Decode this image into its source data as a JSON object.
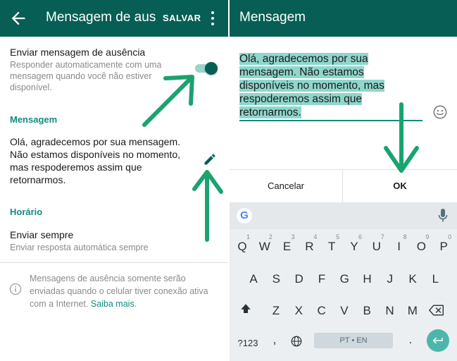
{
  "left": {
    "appbar": {
      "title": "Mensagem de aus",
      "save_label": "SALVAR"
    },
    "toggle_row": {
      "title": "Enviar mensagem de ausência",
      "desc1": "Responder automaticamente com uma",
      "desc2": "mensagem quando você não estiver",
      "desc3": "disponível.",
      "enabled": true
    },
    "message_section": {
      "header": "Mensagem",
      "line1": "Olá, agradecemos por sua mensagem.",
      "line2": "Não estamos disponíveis no momento,",
      "line3": "mas respoderemos assim que",
      "line4": "retornarmos."
    },
    "schedule_section": {
      "header": "Horário",
      "title": "Enviar sempre",
      "desc": "Enviar resposta automática sempre"
    },
    "footer": {
      "line1": "Mensagens de ausência somente serão",
      "line2": "enviadas quando o celular tiver conexão ativa",
      "line3_prefix": "com a Internet. ",
      "link": "Saiba mais",
      "line3_suffix": "."
    }
  },
  "right": {
    "appbar": {
      "title": "Mensagem"
    },
    "input": {
      "line1": "Olá, agradecemos por sua",
      "line2": "mensagem. Não estamos",
      "line3": "disponíveis no momento, mas",
      "line4": "respoderemos assim que",
      "line5": "retornarmos."
    },
    "cancel_label": "Cancelar",
    "ok_label": "OK",
    "keyboard": {
      "row1": [
        "Q",
        "W",
        "E",
        "R",
        "T",
        "Y",
        "U",
        "I",
        "O",
        "P"
      ],
      "row1_hints": [
        "1",
        "2",
        "3",
        "4",
        "5",
        "6",
        "7",
        "8",
        "9",
        "0"
      ],
      "row2": [
        "A",
        "S",
        "D",
        "F",
        "G",
        "H",
        "J",
        "K",
        "L"
      ],
      "row3": [
        "Z",
        "X",
        "C",
        "V",
        "B",
        "N",
        "M"
      ],
      "symbols_label": "?123",
      "comma": ",",
      "period": ".",
      "space_label": "PT • EN",
      "g_label": "G"
    }
  },
  "colors": {
    "appbar": "#075e54",
    "accent": "#128c7e",
    "arrow": "#1aa36f",
    "highlight": "#8fd6cc"
  }
}
